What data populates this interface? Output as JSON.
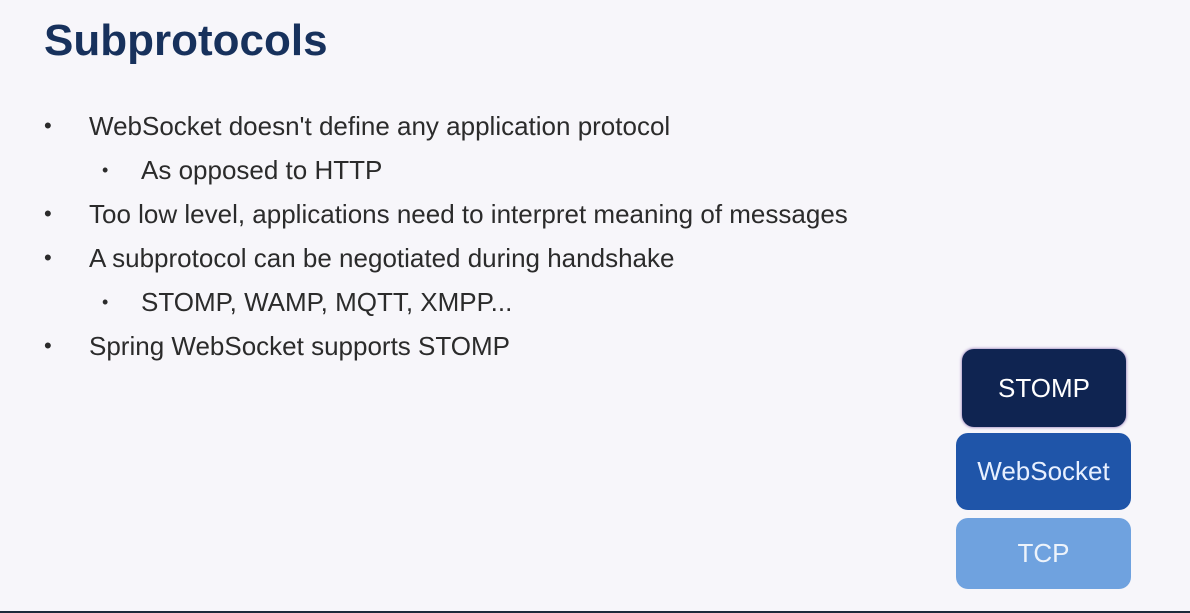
{
  "slide": {
    "title": "Subprotocols",
    "bullets": [
      {
        "level": 1,
        "text": "WebSocket doesn't define any application protocol"
      },
      {
        "level": 2,
        "text": "As opposed to HTTP"
      },
      {
        "level": 1,
        "text": "Too low level, applications need to interpret meaning of messages"
      },
      {
        "level": 1,
        "text": "A subprotocol can be negotiated during handshake"
      },
      {
        "level": 2,
        "text": "STOMP, WAMP, MQTT, XMPP..."
      },
      {
        "level": 1,
        "text": "Spring WebSocket supports STOMP"
      }
    ],
    "bullet_glyph": "•",
    "stack": {
      "top": "STOMP",
      "middle": "WebSocket",
      "bottom": "TCP"
    }
  }
}
